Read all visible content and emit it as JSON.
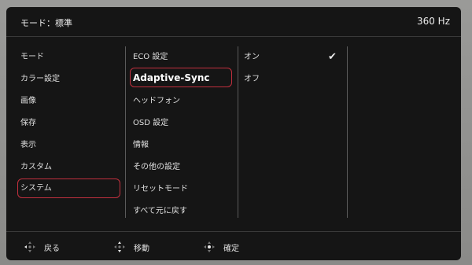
{
  "header": {
    "mode": "モード：標準",
    "refresh_rate": "360 Hz"
  },
  "menu_main": [
    {
      "label": "モード"
    },
    {
      "label": "カラー設定"
    },
    {
      "label": "画像"
    },
    {
      "label": "保存"
    },
    {
      "label": "表示"
    },
    {
      "label": "カスタム"
    },
    {
      "label": "システム"
    }
  ],
  "menu_system": [
    {
      "label": "ECO 設定"
    },
    {
      "label": "Adaptive-Sync"
    },
    {
      "label": "ヘッドフォン"
    },
    {
      "label": "OSD 設定"
    },
    {
      "label": "情報"
    },
    {
      "label": "その他の設定"
    },
    {
      "label": "リセットモード"
    },
    {
      "label": "すべて元に戻す"
    }
  ],
  "options": [
    {
      "label": "オン",
      "checked": true
    },
    {
      "label": "オフ",
      "checked": false
    }
  ],
  "footer": {
    "back": "戻る",
    "move": "移動",
    "confirm": "確定"
  },
  "colors": {
    "selection": "#c2303e",
    "background": "#151515"
  }
}
